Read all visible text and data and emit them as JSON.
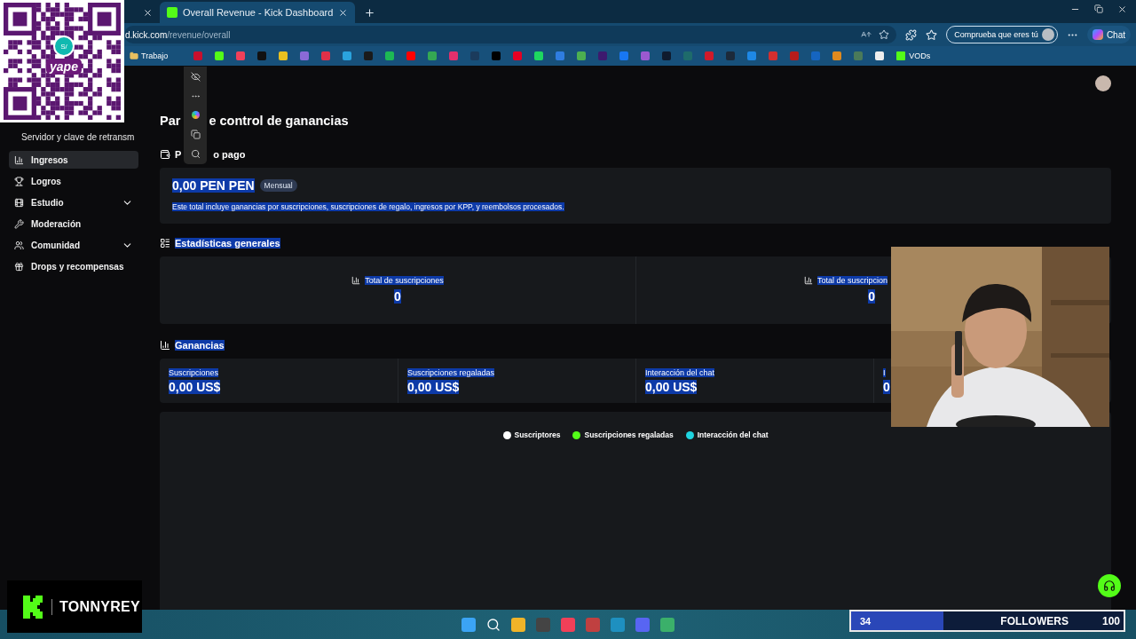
{
  "qr_overlay": {
    "badge": "S/",
    "brand": "yape"
  },
  "browser": {
    "tabs": [
      {
        "selected": false
      },
      {
        "title": "Overall Revenue - Kick Dashboard",
        "selected": true
      }
    ],
    "address": {
      "host": "d.kick.com",
      "path": "/revenue/overall"
    },
    "profile_button": "Comprueba que eres tú",
    "chat_button": "Chat",
    "bookmarks": [
      {
        "kind": "folder",
        "label": "Trabajo"
      },
      {
        "kind": "icon",
        "color": "#c8102e"
      },
      {
        "kind": "icon",
        "color": "#53fc18"
      },
      {
        "kind": "icon",
        "color": "#f0405a"
      },
      {
        "kind": "icon",
        "color": "#111111"
      },
      {
        "kind": "icon",
        "color": "#e8c020"
      },
      {
        "kind": "icon",
        "color": "#8a6ad8"
      },
      {
        "kind": "icon",
        "color": "#e03048"
      },
      {
        "kind": "icon",
        "color": "#2aa3de"
      },
      {
        "kind": "icon",
        "color": "#1a1a1a"
      },
      {
        "kind": "icon",
        "color": "#1db954"
      },
      {
        "kind": "icon",
        "color": "#ff0000"
      },
      {
        "kind": "icon",
        "color": "#34a853"
      },
      {
        "kind": "icon",
        "color": "#e1306c"
      },
      {
        "kind": "icon",
        "color": "#1b3b5c"
      },
      {
        "kind": "icon",
        "color": "#000000"
      },
      {
        "kind": "icon",
        "color": "#e60023"
      },
      {
        "kind": "icon",
        "color": "#1ed760"
      },
      {
        "kind": "icon",
        "color": "#2f7de1"
      },
      {
        "kind": "icon",
        "color": "#4caf50"
      },
      {
        "kind": "icon",
        "color": "#3d1a6e"
      },
      {
        "kind": "icon",
        "color": "#1877f2"
      },
      {
        "kind": "icon",
        "color": "#9b59d0"
      },
      {
        "kind": "icon",
        "color": "#0f1b2e"
      },
      {
        "kind": "icon",
        "color": "#1e6b6b"
      },
      {
        "kind": "icon",
        "color": "#d01a2a"
      },
      {
        "kind": "icon",
        "color": "#1c2a3a"
      },
      {
        "kind": "icon",
        "color": "#1e88e5"
      },
      {
        "kind": "icon",
        "color": "#d32f2f"
      },
      {
        "kind": "icon",
        "color": "#b71c1c"
      },
      {
        "kind": "icon",
        "color": "#1565c0"
      },
      {
        "kind": "icon",
        "color": "#e08a1e"
      },
      {
        "kind": "icon",
        "color": "#4a7a5a"
      },
      {
        "kind": "icon",
        "color": "#eeeeee"
      },
      {
        "kind": "labeled",
        "label": "VODs",
        "color": "#53fc18"
      }
    ]
  },
  "sidebar": {
    "header": "Servidor y clave de retransm",
    "items": [
      {
        "label": "Ingresos",
        "selected": true
      },
      {
        "label": "Logros",
        "selected": false
      },
      {
        "label": "Estudio",
        "selected": false,
        "expanded": false
      },
      {
        "label": "Moderación",
        "selected": false
      },
      {
        "label": "Comunidad",
        "selected": false,
        "expanded": false
      },
      {
        "label": "Drops y recompensas",
        "selected": false
      }
    ]
  },
  "main": {
    "title_parts": [
      "Par",
      "e control de ganancias"
    ],
    "next_payment": {
      "heading_parts": [
        "P",
        "o pago"
      ],
      "amount": "0,00 PEN PEN",
      "period": "Mensual",
      "note": "Este total incluye ganancias por suscripciones, suscripciones de regalo, ingresos por KPP, y reembolsos procesados.",
      "highlighted": true
    },
    "stats": {
      "heading": "Estadísticas generales",
      "highlighted": true,
      "cards": [
        {
          "label": "Total de suscripciones",
          "value": "0",
          "highlighted": true
        },
        {
          "label": "Total de suscripcion",
          "value": "0",
          "highlighted": true
        }
      ]
    },
    "earnings": {
      "heading": "Ganancias",
      "highlighted": true,
      "items": [
        {
          "label": "Suscripciones",
          "value": "0,00 US$",
          "highlighted": true
        },
        {
          "label": "Suscripciones regaladas",
          "value": "0,00 US$",
          "highlighted": true
        },
        {
          "label": "Interacción del chat",
          "value": "0,00 US$",
          "highlighted": true
        },
        {
          "label": "I",
          "value": "0",
          "highlighted": true
        }
      ]
    },
    "legend": [
      {
        "label": "Suscriptores",
        "color": "#ffffff"
      },
      {
        "label": "Suscripciones regaladas",
        "color": "#53fc18"
      },
      {
        "label": "Interacción del chat",
        "color": "#1fd4e0"
      }
    ]
  },
  "kick_overlay": {
    "name": "TONNYREY"
  },
  "followers": {
    "count": "34",
    "label": "FOLLOWERS",
    "goal": "100",
    "level": 0.34
  }
}
